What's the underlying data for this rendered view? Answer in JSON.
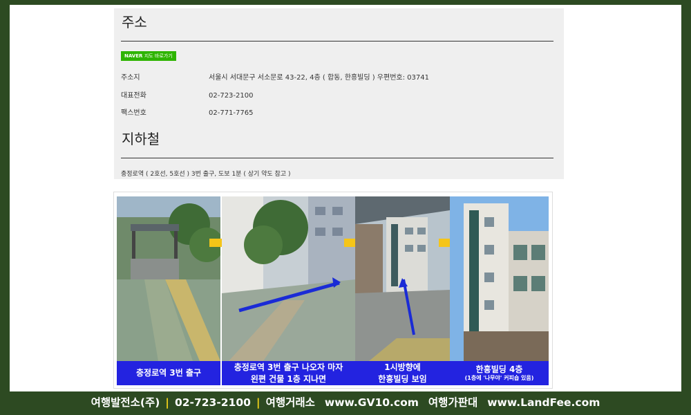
{
  "address_section": {
    "title": "주소",
    "naver_label": "NAVER",
    "naver_suffix": "지도 바로가기",
    "rows": [
      {
        "label": "주소지",
        "value": "서울시 서대문구 서소문로 43-22, 4층 ( 합동, 한흥빌딩 ) 우편번호: 03741"
      },
      {
        "label": "대표전화",
        "value": "02-723-2100"
      },
      {
        "label": "팩스번호",
        "value": "02-771-7765"
      }
    ]
  },
  "subway_section": {
    "title": "지하철",
    "text": "충정로역 ( 2호선, 5호선 ) 3번 출구, 도보 1분 ( 상기 약도 참고 )"
  },
  "photo_strip": {
    "captions": [
      {
        "line1": "충정로역 3번 출구",
        "line2": ""
      },
      {
        "line1": "충정로역 3번 출구 나오자 마자",
        "line2": "왼편 건물 1층 지나면"
      },
      {
        "line1": "1시방향에",
        "line2": "한흥빌딩 보임"
      },
      {
        "line1": "한흥빌딩 4층",
        "line2": "(1층에 '나무야' 커피숍 있음)"
      }
    ],
    "colors": {
      "caption_bg": "#2323e0",
      "arrow": "#f5c518"
    }
  },
  "footer": {
    "company": "여행발전소(주)",
    "phone": "02-723-2100",
    "brand1": "여행거래소",
    "site1": "www.GV10.com",
    "brand2": "여행가판대",
    "site2": "www.LandFee.com"
  }
}
